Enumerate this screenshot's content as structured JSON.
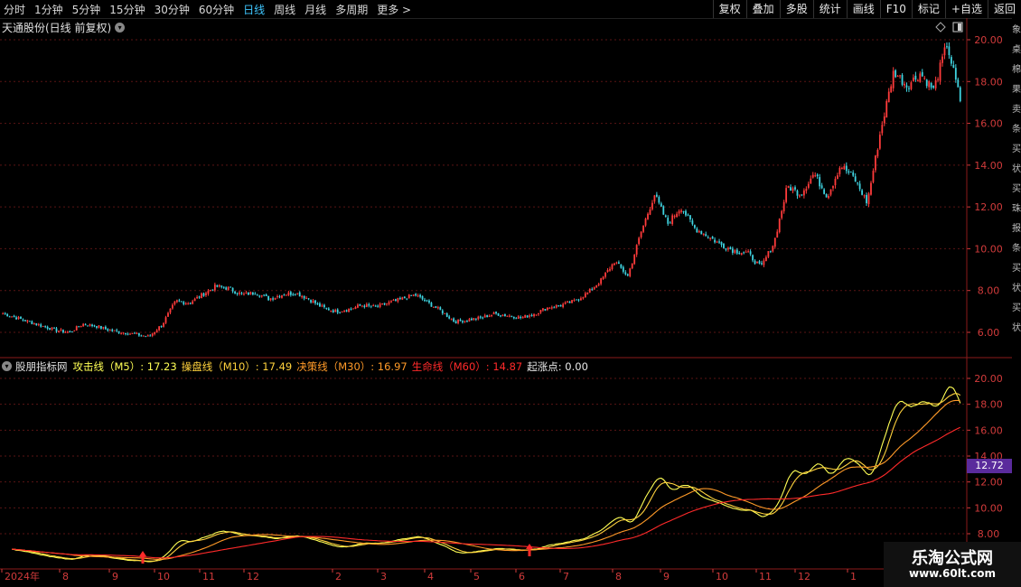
{
  "toolbar": {
    "periods": [
      "分时",
      "1分钟",
      "5分钟",
      "15分钟",
      "30分钟",
      "60分钟",
      "日线",
      "周线",
      "月线",
      "多周期",
      "更多 >"
    ],
    "active_period": "日线",
    "buttons": [
      "复权",
      "叠加",
      "多股",
      "统计",
      "画线",
      "F10",
      "标记",
      "+自选",
      "返回"
    ]
  },
  "main_chart": {
    "title": "天通股份(日线 前复权)",
    "y_ticks": [
      "20.00",
      "18.00",
      "16.00",
      "14.00",
      "12.00",
      "10.00",
      "8.00",
      "6.00"
    ],
    "price_series": [
      6.9,
      6.7,
      6.5,
      6.3,
      6.1,
      6.0,
      6.4,
      6.3,
      6.1,
      6.0,
      5.9,
      5.8,
      6.4,
      7.5,
      7.4,
      7.8,
      8.2,
      8.1,
      7.8,
      7.9,
      7.6,
      7.8,
      7.9,
      7.6,
      7.2,
      7.0,
      7.1,
      7.3,
      7.2,
      7.4,
      7.6,
      7.8,
      7.4,
      7.0,
      6.5,
      6.6,
      6.7,
      6.9,
      6.8,
      6.7,
      6.9,
      7.2,
      7.3,
      7.5,
      7.9,
      8.5,
      9.4,
      8.7,
      10.8,
      12.6,
      11.2,
      12.0,
      11.0,
      10.6,
      10.2,
      9.9,
      9.8,
      9.1,
      10.3,
      13.0,
      12.6,
      13.6,
      12.5,
      14.0,
      13.4,
      12.2,
      15.6,
      18.5,
      17.8,
      18.4,
      17.6,
      19.8,
      17.1
    ]
  },
  "indicator": {
    "name": "股朋指标网",
    "lines": [
      {
        "label": "攻击线（M5）: 17.23",
        "color": "#ffff55"
      },
      {
        "label": "操盘线（M10）: 17.49",
        "color": "#ffd23d"
      },
      {
        "label": "决策线（M30）: 16.97",
        "color": "#ff9a28"
      },
      {
        "label": "生命线（M60）: 14.87",
        "color": "#ff2a2a"
      },
      {
        "label": "起涨点: 0.00",
        "color": "#e8e8e8"
      }
    ],
    "y_ticks": [
      "20.00",
      "18.00",
      "16.00",
      "14.00",
      "12.00",
      "10.00",
      "8.00"
    ],
    "price_tag": "12.72",
    "price_tag_color": "#5a2b9c"
  },
  "x_axis": {
    "labels": [
      "2024年",
      "8",
      "9",
      "10",
      "11",
      "12",
      "2",
      "3",
      "4",
      "5",
      "6",
      "7",
      "8",
      "9",
      "10",
      "11",
      "12",
      "1"
    ]
  },
  "right_strip_chars": [
    "象",
    "桌",
    "棉",
    "果",
    "卖",
    "条",
    "买",
    "状",
    "买",
    "珠",
    "报",
    "条",
    "买",
    "状",
    "买",
    "状"
  ],
  "logo": {
    "title": "乐淘公式网",
    "url": "www.60lt.com"
  }
}
